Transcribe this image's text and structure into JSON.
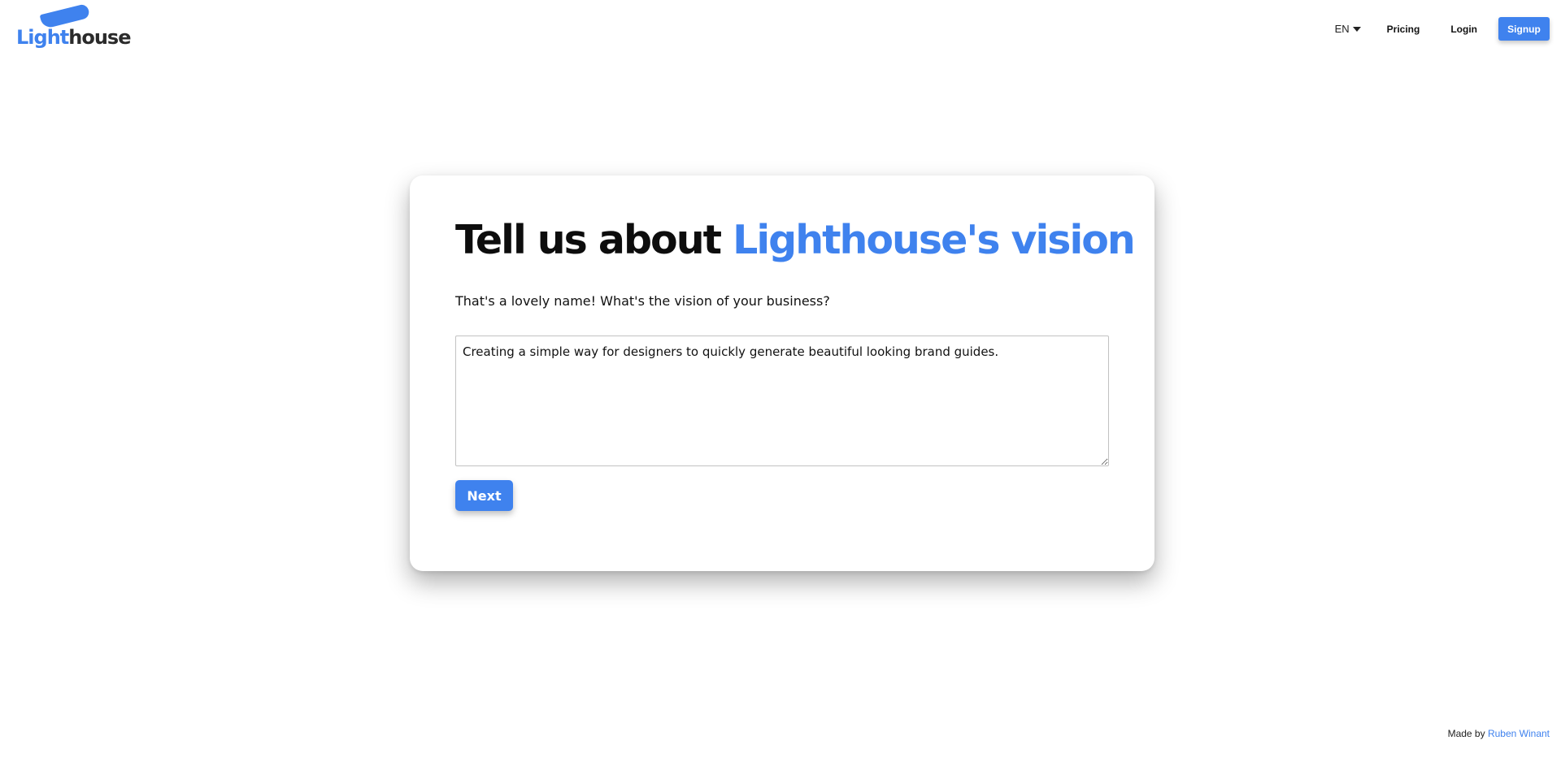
{
  "header": {
    "logo": {
      "part_light": "Light",
      "part_house": "house",
      "brand_color": "#3f82ee"
    },
    "language": {
      "selected": "EN",
      "icon": "caret-down-icon"
    },
    "nav": {
      "pricing_label": "Pricing",
      "login_label": "Login",
      "signup_label": "Signup"
    }
  },
  "card": {
    "title_prefix": "Tell us about",
    "title_accent": "Lighthouse's vision",
    "subtitle": "That's a lovely name! What's the vision of your business?",
    "vision_input": {
      "value": "Creating a simple way for designers to quickly generate beautiful looking brand guides.",
      "placeholder": ""
    },
    "next_label": "Next"
  },
  "footer": {
    "made_by_label": "Made by",
    "author": "Ruben Winant"
  },
  "colors": {
    "accent": "#3f82ee",
    "text": "#111111",
    "background": "#ffffff"
  }
}
